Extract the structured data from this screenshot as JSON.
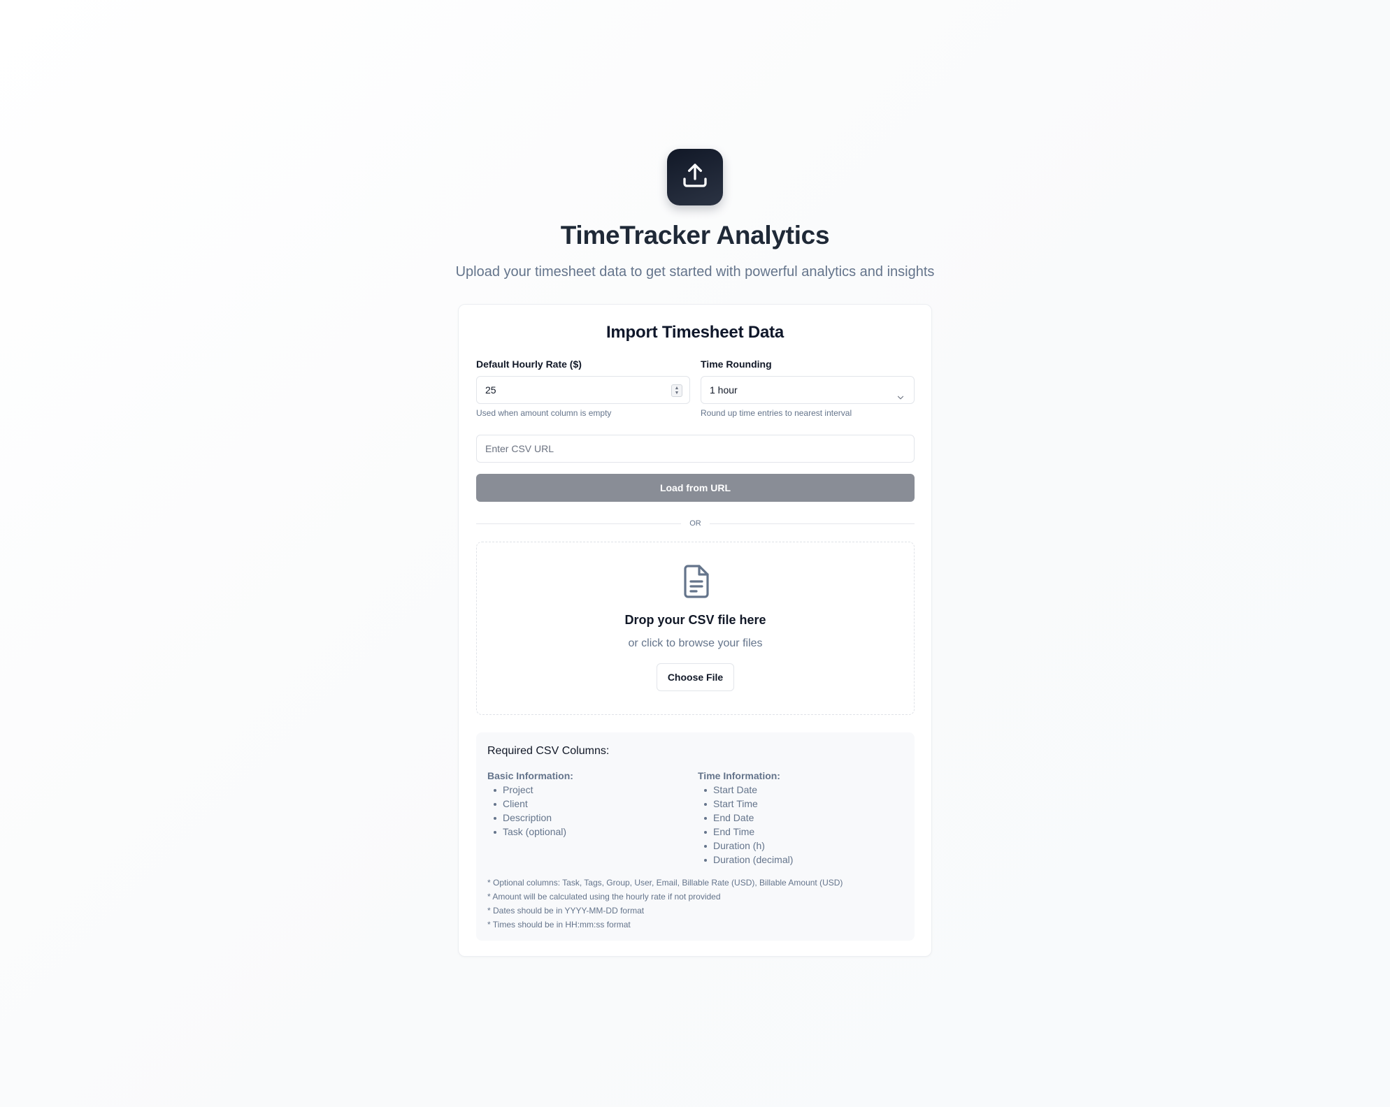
{
  "header": {
    "logo_icon": "upload-icon",
    "title": "TimeTracker Analytics",
    "subtitle": "Upload your timesheet data to get started with powerful analytics and insights"
  },
  "card": {
    "title": "Import Timesheet Data",
    "hourly_rate": {
      "label": "Default Hourly Rate ($)",
      "value": "25",
      "hint": "Used when amount column is empty"
    },
    "time_rounding": {
      "label": "Time Rounding",
      "value": "1 hour",
      "hint": "Round up time entries to nearest interval"
    },
    "url_input": {
      "placeholder": "Enter CSV URL"
    },
    "load_button": "Load from URL",
    "divider": "OR",
    "dropzone": {
      "icon": "file-text-icon",
      "title": "Drop your CSV file here",
      "subtitle": "or click to browse your files",
      "button": "Choose File"
    },
    "requirements": {
      "title": "Required CSV Columns:",
      "basic": {
        "heading": "Basic Information:",
        "items": [
          "Project",
          "Client",
          "Description",
          "Task (optional)"
        ]
      },
      "time": {
        "heading": "Time Information:",
        "items": [
          "Start Date",
          "Start Time",
          "End Date",
          "End Time",
          "Duration (h)",
          "Duration (decimal)"
        ]
      },
      "notes": [
        "* Optional columns: Task, Tags, Group, User, Email, Billable Rate (USD), Billable Amount (USD)",
        "* Amount will be calculated using the hourly rate if not provided",
        "* Dates should be in YYYY-MM-DD format",
        "* Times should be in HH:mm:ss format"
      ]
    }
  },
  "colors": {
    "logo_bg": "#1f2937",
    "title": "#1f2937",
    "muted_text": "#64748b",
    "load_button_bg": "#898d96"
  }
}
